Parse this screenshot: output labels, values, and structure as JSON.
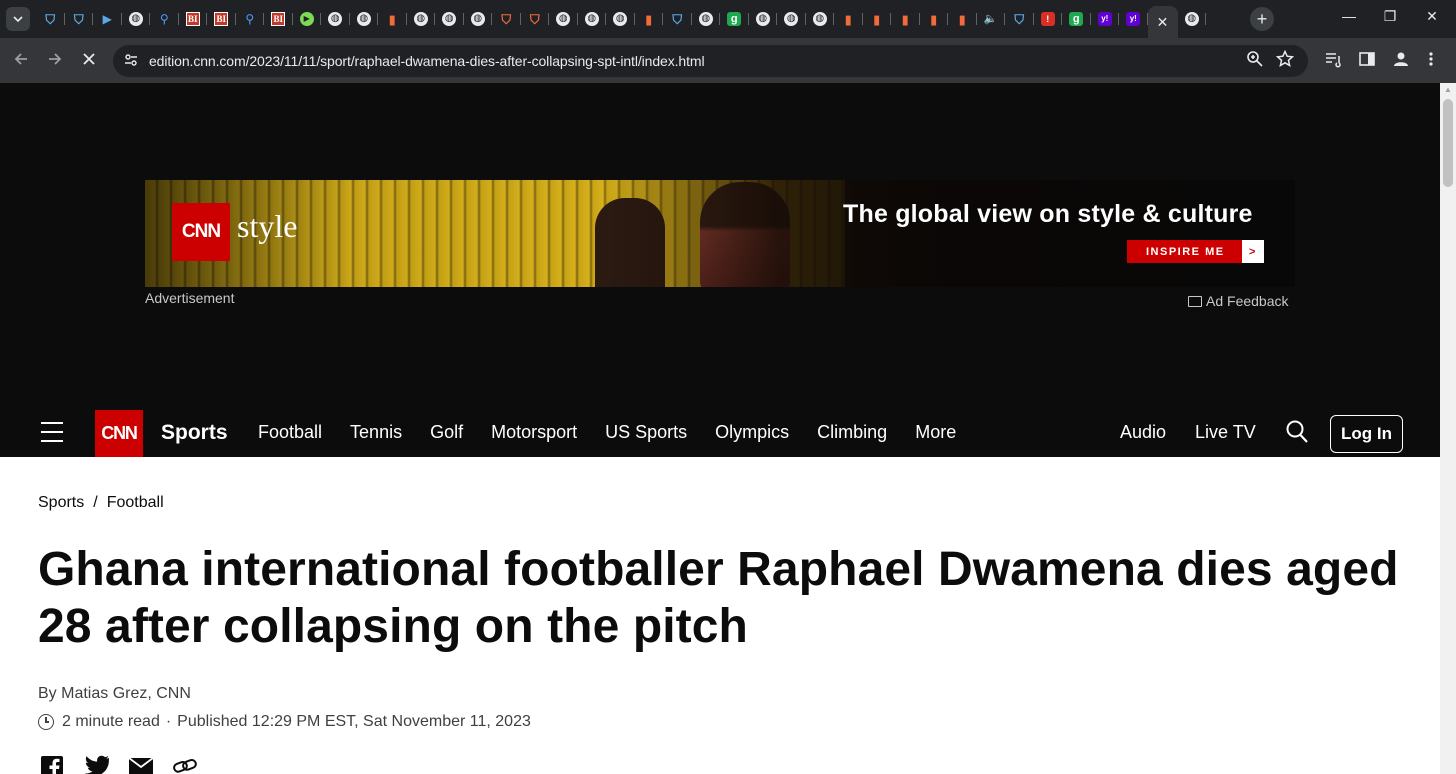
{
  "browser": {
    "tabs": [
      {
        "icon": "shield-icon",
        "fav": "shield"
      },
      {
        "icon": "shield-icon",
        "fav": "shield"
      },
      {
        "icon": "arrow-icon",
        "fav": "dark-arrow"
      },
      {
        "icon": "globe-icon",
        "fav": "globe"
      },
      {
        "icon": "search-icon",
        "fav": "search"
      },
      {
        "icon": "business-insider-icon",
        "fav": "bi"
      },
      {
        "icon": "business-insider-icon",
        "fav": "bi"
      },
      {
        "icon": "search-icon",
        "fav": "search"
      },
      {
        "icon": "business-insider-icon",
        "fav": "bi"
      },
      {
        "icon": "play-icon",
        "fav": "play"
      },
      {
        "icon": "globe-icon",
        "fav": "globe"
      },
      {
        "icon": "globe-icon",
        "fav": "globe"
      },
      {
        "icon": "bookmark-icon",
        "fav": "bookmark"
      },
      {
        "icon": "globe-icon",
        "fav": "globe"
      },
      {
        "icon": "globe-icon",
        "fav": "globe"
      },
      {
        "icon": "globe-icon",
        "fav": "globe"
      },
      {
        "icon": "u-shield-icon",
        "fav": "ushield"
      },
      {
        "icon": "u-shield-icon",
        "fav": "ushield"
      },
      {
        "icon": "globe-icon",
        "fav": "globe"
      },
      {
        "icon": "globe-icon",
        "fav": "globe"
      },
      {
        "icon": "globe-icon",
        "fav": "globe"
      },
      {
        "icon": "bookmark-icon",
        "fav": "bookmark"
      },
      {
        "icon": "shield-icon",
        "fav": "shield"
      },
      {
        "icon": "globe-icon",
        "fav": "globe"
      },
      {
        "icon": "green-g-icon",
        "fav": "green-g"
      },
      {
        "icon": "globe-icon",
        "fav": "globe"
      },
      {
        "icon": "globe-icon",
        "fav": "globe"
      },
      {
        "icon": "globe-icon",
        "fav": "globe"
      },
      {
        "icon": "bookmark-icon",
        "fav": "bookmark"
      },
      {
        "icon": "bookmark-icon",
        "fav": "bookmark"
      },
      {
        "icon": "bookmark-icon",
        "fav": "bookmark"
      },
      {
        "icon": "bookmark-icon",
        "fav": "bookmark"
      },
      {
        "icon": "bookmark-icon",
        "fav": "bookmark"
      },
      {
        "icon": "speaker-icon",
        "fav": "audio"
      },
      {
        "icon": "shield-icon",
        "fav": "shield"
      },
      {
        "icon": "red-icon",
        "fav": "red-i"
      },
      {
        "icon": "green-g-icon",
        "fav": "green-g"
      },
      {
        "icon": "yahoo-icon",
        "fav": "yahoo"
      },
      {
        "icon": "yahoo-icon",
        "fav": "yahoo"
      }
    ],
    "url_host": "edition.cnn.com",
    "url_path": "/2023/11/11/sport/raphael-dwamena-dies-after-collapsing-spt-intl/index.html"
  },
  "ad": {
    "logo_text": "CNN",
    "brand_text": "style",
    "headline": "The global view on style & culture",
    "cta": "INSPIRE ME",
    "cta_arrow": ">",
    "label": "Advertisement",
    "feedback": "Ad Feedback"
  },
  "nav": {
    "logo_text": "CNN",
    "section": "Sports",
    "links": [
      "Football",
      "Tennis",
      "Golf",
      "Motorsport",
      "US Sports",
      "Olympics",
      "Climbing",
      "More"
    ],
    "audio": "Audio",
    "live_tv": "Live TV",
    "login": "Log In"
  },
  "article": {
    "breadcrumb": [
      "Sports",
      "Football"
    ],
    "breadcrumb_sep": "/",
    "headline": "Ghana international footballer Raphael Dwamena dies aged 28 after collapsing on the pitch",
    "byline": "By Matias Grez, CNN",
    "read_time": "2 minute read",
    "published": "Published 12:29 PM EST, Sat November 11, 2023"
  },
  "colors": {
    "cnn_red": "#cc0000",
    "page_dark": "#0c0c0c"
  }
}
